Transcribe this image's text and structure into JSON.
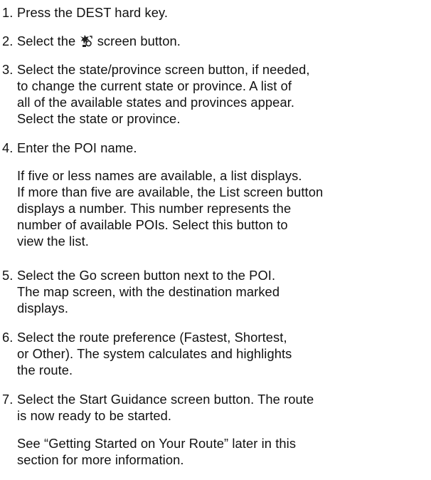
{
  "steps": [
    {
      "number": "1.",
      "lines": [
        "Press the DEST hard key."
      ]
    },
    {
      "number": "2.",
      "before_icon": "Select the",
      "icon": "poi-category-icon",
      "after_icon": "screen button."
    },
    {
      "number": "3.",
      "lines": [
        "Select the state/province screen button, if needed,",
        "to change the current state or province. A list of",
        "all of the available states and provinces appear.",
        "Select the state or province."
      ]
    },
    {
      "number": "4.",
      "lines": [
        "Enter the POI name."
      ],
      "note_lines": [
        "If five or less names are available, a list displays.",
        "If more than five are available, the List screen button",
        "displays a number. This number represents the",
        "number of available POIs. Select this button to",
        "view the list."
      ]
    },
    {
      "number": "5.",
      "lines": [
        "Select the Go screen button next to the POI.",
        "The map screen, with the destination marked",
        "displays."
      ]
    },
    {
      "number": "6.",
      "lines": [
        "Select the route preference (Fastest, Shortest,",
        "or Other). The system calculates and highlights",
        "the route."
      ]
    },
    {
      "number": "7.",
      "lines": [
        "Select the Start Guidance screen button. The route",
        "is now ready to be started."
      ],
      "note_lines": [
        "See “Getting Started on Your Route” later in this",
        "section for more information."
      ]
    }
  ]
}
